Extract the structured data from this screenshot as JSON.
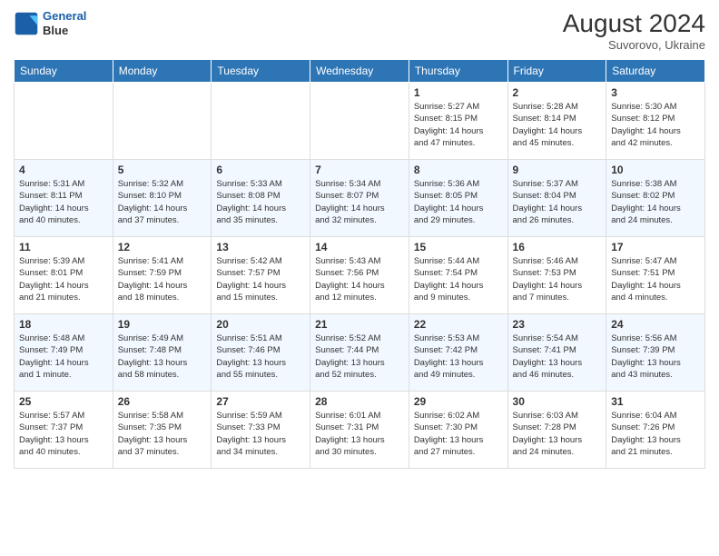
{
  "header": {
    "logo_line1": "General",
    "logo_line2": "Blue",
    "month_year": "August 2024",
    "location": "Suvorovo, Ukraine"
  },
  "days_of_week": [
    "Sunday",
    "Monday",
    "Tuesday",
    "Wednesday",
    "Thursday",
    "Friday",
    "Saturday"
  ],
  "weeks": [
    [
      {
        "day": "",
        "info": ""
      },
      {
        "day": "",
        "info": ""
      },
      {
        "day": "",
        "info": ""
      },
      {
        "day": "",
        "info": ""
      },
      {
        "day": "1",
        "info": "Sunrise: 5:27 AM\nSunset: 8:15 PM\nDaylight: 14 hours\nand 47 minutes."
      },
      {
        "day": "2",
        "info": "Sunrise: 5:28 AM\nSunset: 8:14 PM\nDaylight: 14 hours\nand 45 minutes."
      },
      {
        "day": "3",
        "info": "Sunrise: 5:30 AM\nSunset: 8:12 PM\nDaylight: 14 hours\nand 42 minutes."
      }
    ],
    [
      {
        "day": "4",
        "info": "Sunrise: 5:31 AM\nSunset: 8:11 PM\nDaylight: 14 hours\nand 40 minutes."
      },
      {
        "day": "5",
        "info": "Sunrise: 5:32 AM\nSunset: 8:10 PM\nDaylight: 14 hours\nand 37 minutes."
      },
      {
        "day": "6",
        "info": "Sunrise: 5:33 AM\nSunset: 8:08 PM\nDaylight: 14 hours\nand 35 minutes."
      },
      {
        "day": "7",
        "info": "Sunrise: 5:34 AM\nSunset: 8:07 PM\nDaylight: 14 hours\nand 32 minutes."
      },
      {
        "day": "8",
        "info": "Sunrise: 5:36 AM\nSunset: 8:05 PM\nDaylight: 14 hours\nand 29 minutes."
      },
      {
        "day": "9",
        "info": "Sunrise: 5:37 AM\nSunset: 8:04 PM\nDaylight: 14 hours\nand 26 minutes."
      },
      {
        "day": "10",
        "info": "Sunrise: 5:38 AM\nSunset: 8:02 PM\nDaylight: 14 hours\nand 24 minutes."
      }
    ],
    [
      {
        "day": "11",
        "info": "Sunrise: 5:39 AM\nSunset: 8:01 PM\nDaylight: 14 hours\nand 21 minutes."
      },
      {
        "day": "12",
        "info": "Sunrise: 5:41 AM\nSunset: 7:59 PM\nDaylight: 14 hours\nand 18 minutes."
      },
      {
        "day": "13",
        "info": "Sunrise: 5:42 AM\nSunset: 7:57 PM\nDaylight: 14 hours\nand 15 minutes."
      },
      {
        "day": "14",
        "info": "Sunrise: 5:43 AM\nSunset: 7:56 PM\nDaylight: 14 hours\nand 12 minutes."
      },
      {
        "day": "15",
        "info": "Sunrise: 5:44 AM\nSunset: 7:54 PM\nDaylight: 14 hours\nand 9 minutes."
      },
      {
        "day": "16",
        "info": "Sunrise: 5:46 AM\nSunset: 7:53 PM\nDaylight: 14 hours\nand 7 minutes."
      },
      {
        "day": "17",
        "info": "Sunrise: 5:47 AM\nSunset: 7:51 PM\nDaylight: 14 hours\nand 4 minutes."
      }
    ],
    [
      {
        "day": "18",
        "info": "Sunrise: 5:48 AM\nSunset: 7:49 PM\nDaylight: 14 hours\nand 1 minute."
      },
      {
        "day": "19",
        "info": "Sunrise: 5:49 AM\nSunset: 7:48 PM\nDaylight: 13 hours\nand 58 minutes."
      },
      {
        "day": "20",
        "info": "Sunrise: 5:51 AM\nSunset: 7:46 PM\nDaylight: 13 hours\nand 55 minutes."
      },
      {
        "day": "21",
        "info": "Sunrise: 5:52 AM\nSunset: 7:44 PM\nDaylight: 13 hours\nand 52 minutes."
      },
      {
        "day": "22",
        "info": "Sunrise: 5:53 AM\nSunset: 7:42 PM\nDaylight: 13 hours\nand 49 minutes."
      },
      {
        "day": "23",
        "info": "Sunrise: 5:54 AM\nSunset: 7:41 PM\nDaylight: 13 hours\nand 46 minutes."
      },
      {
        "day": "24",
        "info": "Sunrise: 5:56 AM\nSunset: 7:39 PM\nDaylight: 13 hours\nand 43 minutes."
      }
    ],
    [
      {
        "day": "25",
        "info": "Sunrise: 5:57 AM\nSunset: 7:37 PM\nDaylight: 13 hours\nand 40 minutes."
      },
      {
        "day": "26",
        "info": "Sunrise: 5:58 AM\nSunset: 7:35 PM\nDaylight: 13 hours\nand 37 minutes."
      },
      {
        "day": "27",
        "info": "Sunrise: 5:59 AM\nSunset: 7:33 PM\nDaylight: 13 hours\nand 34 minutes."
      },
      {
        "day": "28",
        "info": "Sunrise: 6:01 AM\nSunset: 7:31 PM\nDaylight: 13 hours\nand 30 minutes."
      },
      {
        "day": "29",
        "info": "Sunrise: 6:02 AM\nSunset: 7:30 PM\nDaylight: 13 hours\nand 27 minutes."
      },
      {
        "day": "30",
        "info": "Sunrise: 6:03 AM\nSunset: 7:28 PM\nDaylight: 13 hours\nand 24 minutes."
      },
      {
        "day": "31",
        "info": "Sunrise: 6:04 AM\nSunset: 7:26 PM\nDaylight: 13 hours\nand 21 minutes."
      }
    ]
  ]
}
